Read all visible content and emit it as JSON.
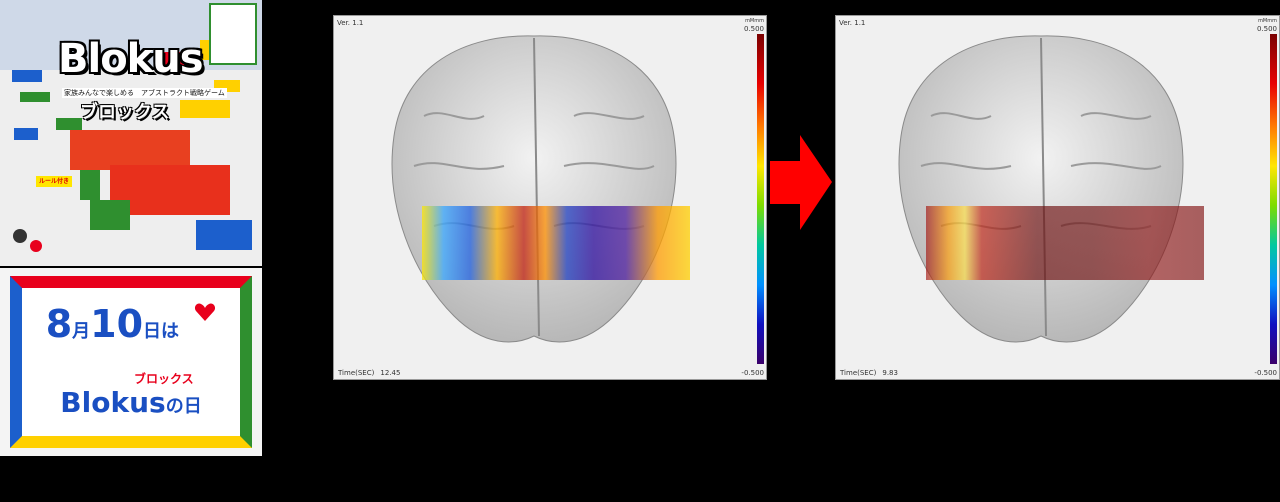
{
  "box": {
    "logo": "Blokus",
    "tagline": "家族みんなで楽しめる　アブストラクト戦略ゲーム",
    "kana": "ブロックス",
    "note": "ルール付き"
  },
  "poster": {
    "month": "8",
    "month_suffix": "月",
    "day": "10",
    "day_suffix": "日は",
    "kana": "ブロックス",
    "brand": "Blokus",
    "brand_suffix": "の日"
  },
  "viewer_left": {
    "version": "Ver. 1.1",
    "time_label": "Time(SEC)",
    "time_value": "12.45",
    "scale_unit": "mMmm",
    "scale_max": "0.500",
    "scale_min": "-0.500"
  },
  "viewer_right": {
    "version": "Ver. 1.1",
    "time_label": "Time(SEC)",
    "time_value": "9.83",
    "scale_unit": "mMmm",
    "scale_max": "0.500",
    "scale_min": "-0.500"
  },
  "colors": {
    "arrow": "#ff0000",
    "background": "#000000",
    "viewer_bg": "#f0f0f0"
  }
}
